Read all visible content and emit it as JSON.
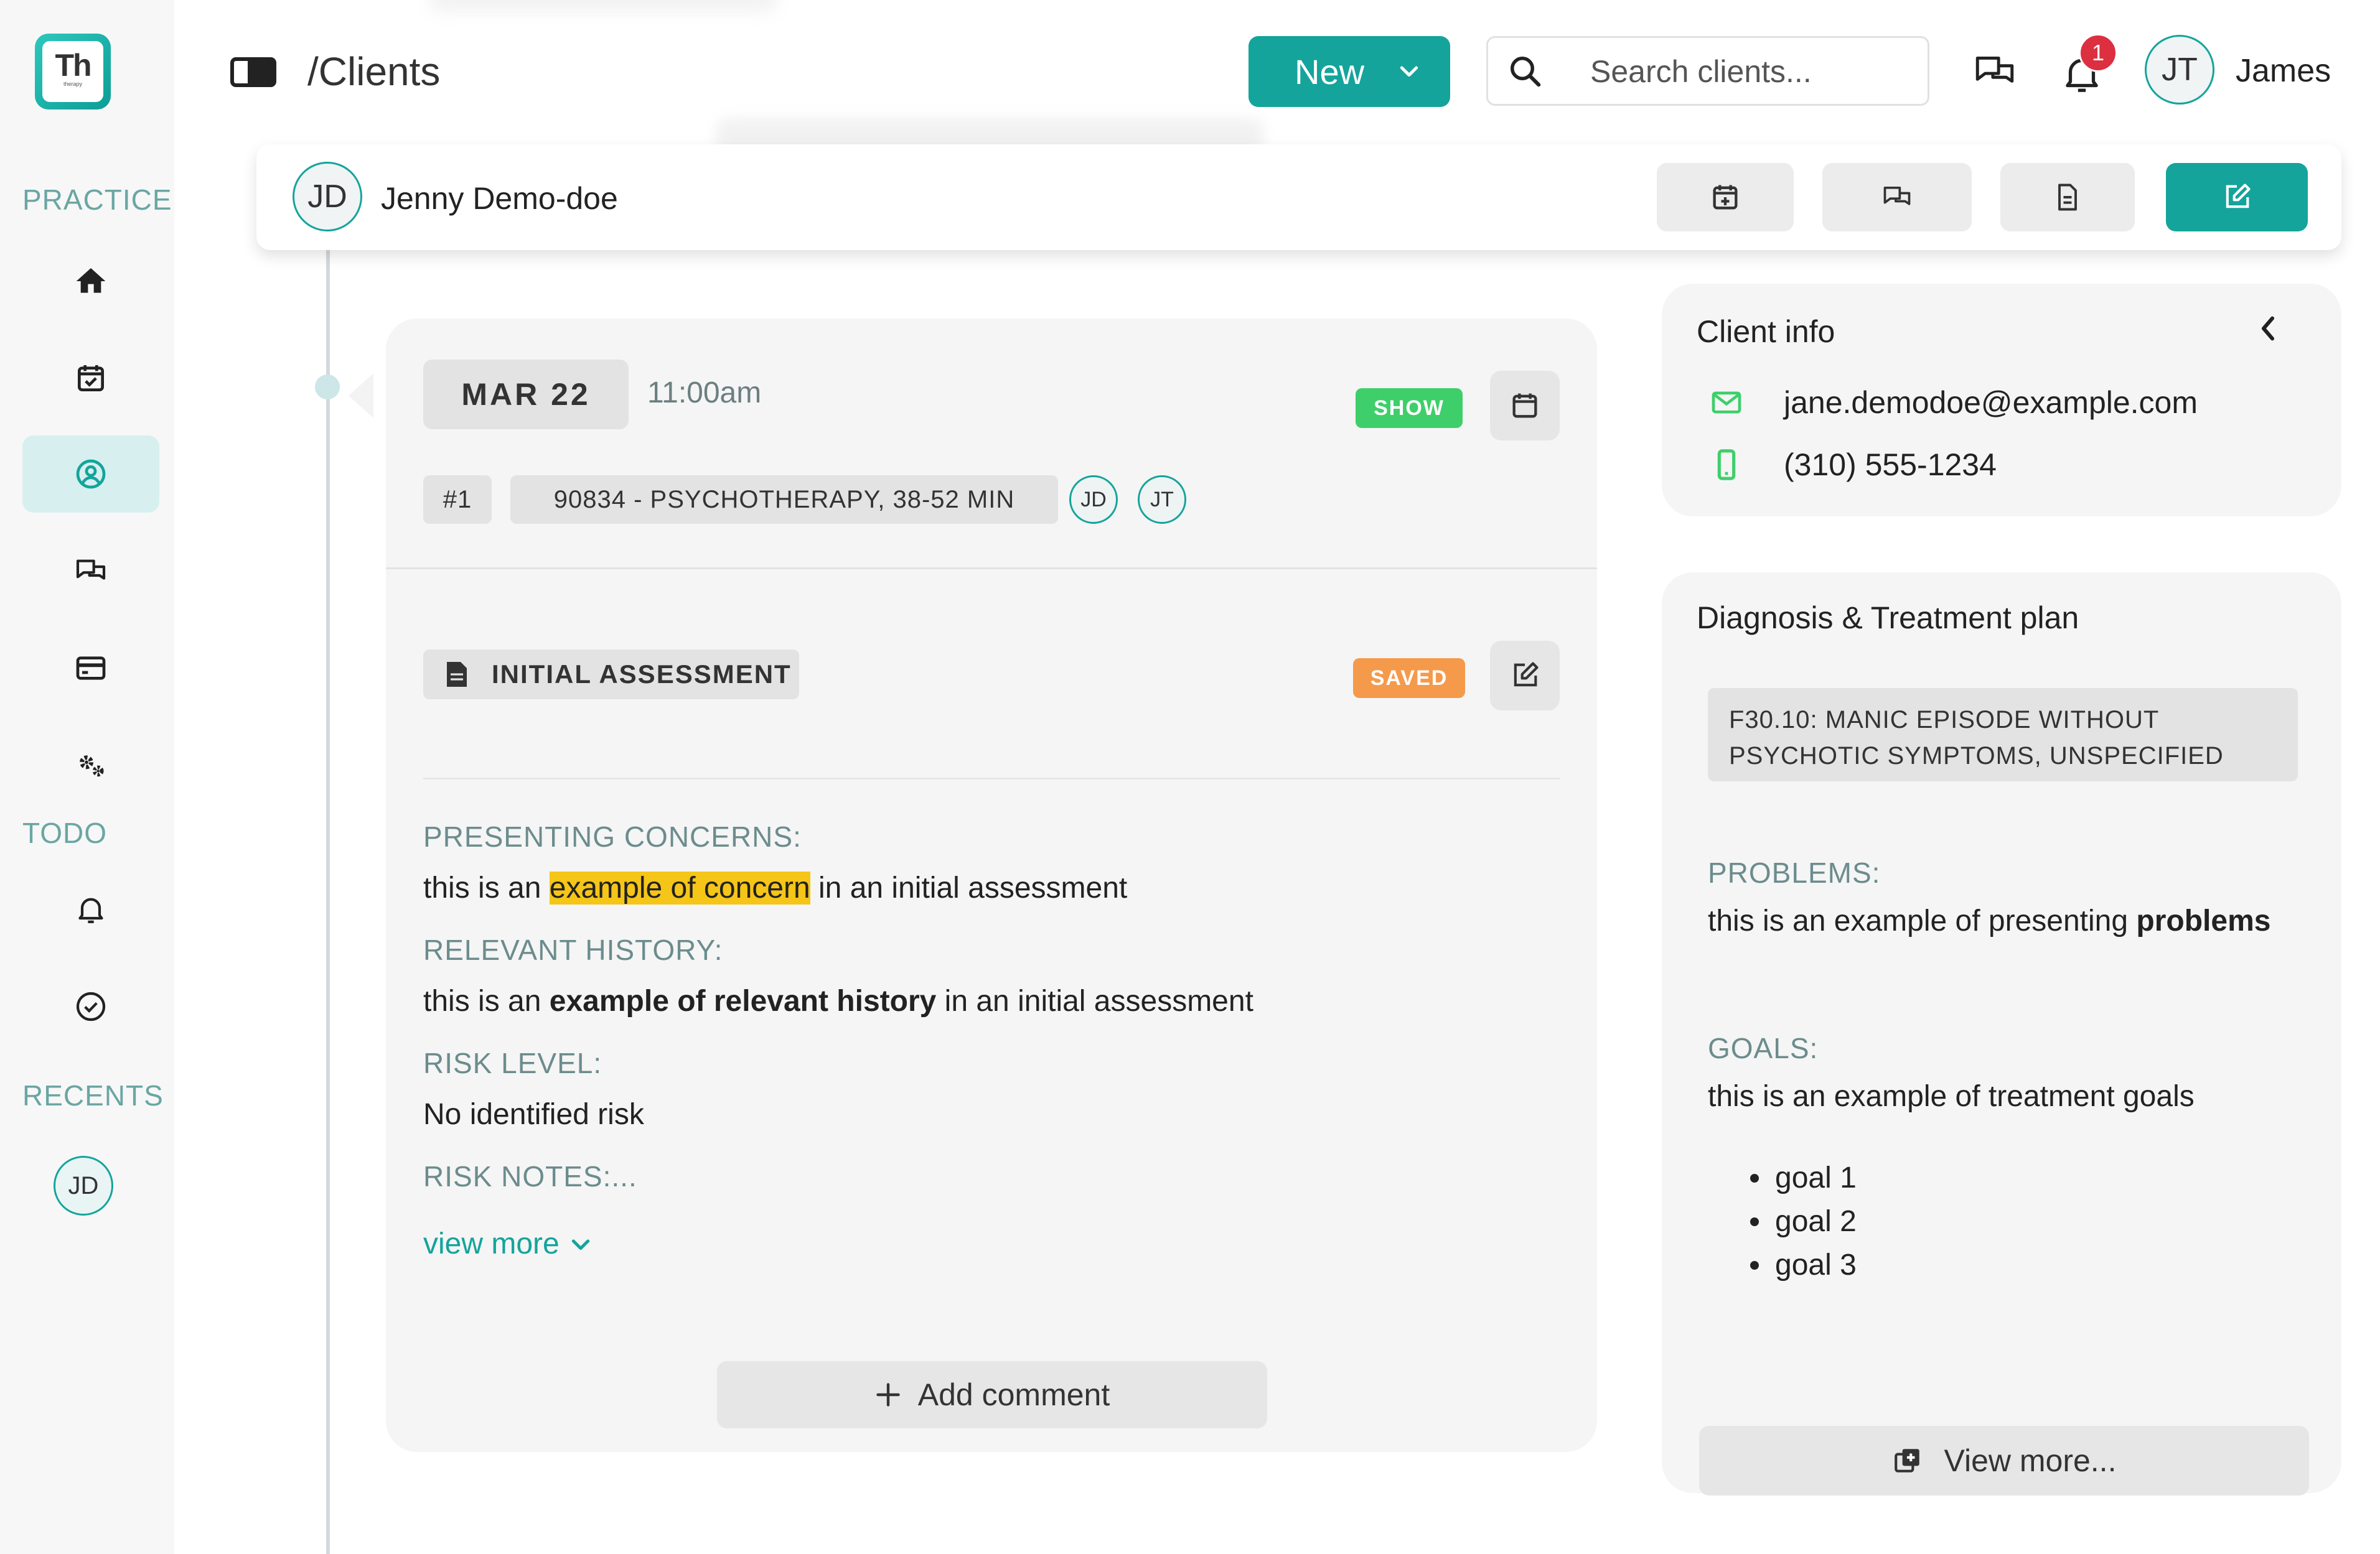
{
  "app": {
    "logo_text": "Th",
    "logo_sub": "therapy",
    "breadcrumb": "/Clients",
    "new_button": "New",
    "search_placeholder": "Search clients...",
    "notification_count": "1",
    "user_initials": "JT",
    "user_name": "James"
  },
  "sidebar": {
    "sections": [
      "PRACTICE",
      "TODO",
      "RECENTS"
    ],
    "practice_items": [
      {
        "icon": "home-icon"
      },
      {
        "icon": "calendar-check-icon"
      },
      {
        "icon": "user-circle-icon",
        "active": true
      },
      {
        "icon": "chat-icon"
      },
      {
        "icon": "credit-card-icon"
      },
      {
        "icon": "gears-icon"
      }
    ],
    "todo_items": [
      {
        "icon": "bell-icon"
      },
      {
        "icon": "check-circle-icon"
      }
    ],
    "recents": [
      "JD"
    ]
  },
  "client": {
    "initials": "JD",
    "name": "Jenny Demo-doe"
  },
  "appointment": {
    "date": "MAR 22",
    "time": "11:00am",
    "status": "SHOW",
    "number": "#1",
    "service": "90834 - PSYCHOTHERAPY, 38-52 MIN",
    "participants": [
      "JD",
      "JT"
    ]
  },
  "note": {
    "type": "INITIAL ASSESSMENT",
    "status": "SAVED",
    "fields": {
      "presenting_label": "PRESENTING CONCERNS:",
      "presenting_pre": "this is an ",
      "presenting_highlight": "example of concern",
      "presenting_post": " in an initial assessment",
      "history_label": "RELEVANT HISTORY:",
      "history_pre": "this is an ",
      "history_bold": "example of relevant history",
      "history_post": " in an initial assessment",
      "risk_label": "RISK LEVEL:",
      "risk_value": "No identified risk",
      "risk_notes_label": "RISK NOTES:..."
    },
    "view_more": "view more",
    "add_comment": "Add comment"
  },
  "client_info": {
    "title": "Client info",
    "email": "jane.demodoe@example.com",
    "phone": "(310) 555-1234"
  },
  "diagnosis": {
    "title": "Diagnosis & Treatment plan",
    "code_line1": "F30.10: MANIC EPISODE WITHOUT",
    "code_line2": "PSYCHOTIC SYMPTOMS, UNSPECIFIED",
    "problems_label": "PROBLEMS:",
    "problems_pre": "this is an example of presenting ",
    "problems_bold": "problems",
    "goals_label": "GOALS:",
    "goals_text": "this is an example of treatment goals",
    "goals": [
      "goal 1",
      "goal 2",
      "goal 3"
    ],
    "view_more": "View more..."
  },
  "colors": {
    "brand": "#14a49b",
    "show_tag": "#3ecf6a",
    "saved_tag": "#f59a4b",
    "highlight": "#f5c518",
    "badge": "#dc2f3f"
  }
}
